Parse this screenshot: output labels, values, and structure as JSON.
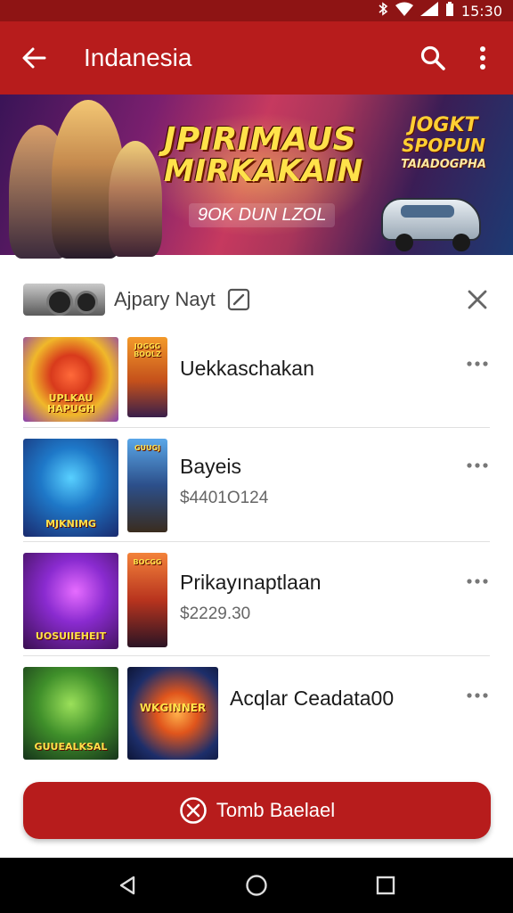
{
  "status_bar": {
    "time": "15:30",
    "icons": [
      "bluetooth-icon",
      "wifi-icon",
      "signal-icon",
      "battery-icon"
    ]
  },
  "app_bar": {
    "title": "Indanesia",
    "back_icon": "arrow-left-icon",
    "search_icon": "search-icon",
    "menu_icon": "more-vert-icon"
  },
  "banner": {
    "line1": "JPIRIMAUS",
    "line2": "MIRKAKAIN",
    "line3": "9OK DUN LZOL",
    "side_line1": "JOGKT",
    "side_line2": "SPOPUN",
    "side_line3": "TAIADOGPHA"
  },
  "list_header": {
    "label": "Ajpary Nayt",
    "edit_icon": "edit-icon",
    "close_icon": "close-icon"
  },
  "games": [
    {
      "name": "Uekkaschakan",
      "price": "",
      "thumb_text": "UPLKAU HAPUGH",
      "small_thumb_text": "JOGGG BOOLZ"
    },
    {
      "name": "Bayeis",
      "price": "$4401O124",
      "thumb_text": "MJKNIMG",
      "small_thumb_text": "GUUGJ"
    },
    {
      "name": "Prikayınaptlaan",
      "price": "$2229.30",
      "thumb_text": "UOSUIIEHEIT",
      "small_thumb_text": "BOCGG"
    },
    {
      "name": "Acqlar Ceadata00",
      "price": "",
      "thumb_text": "GUUEALKSAL",
      "small_thumb_text": "WKGINNER"
    }
  ],
  "primary_button": {
    "label": "Tomb Baelael",
    "icon": "cancel-circle-icon"
  },
  "nav_bar": {
    "back": "nav-back-icon",
    "home": "nav-home-icon",
    "recents": "nav-recents-icon"
  },
  "colors": {
    "primary": "#b71c1c",
    "status_bar": "#8e1414",
    "nav_bar": "#000000"
  }
}
